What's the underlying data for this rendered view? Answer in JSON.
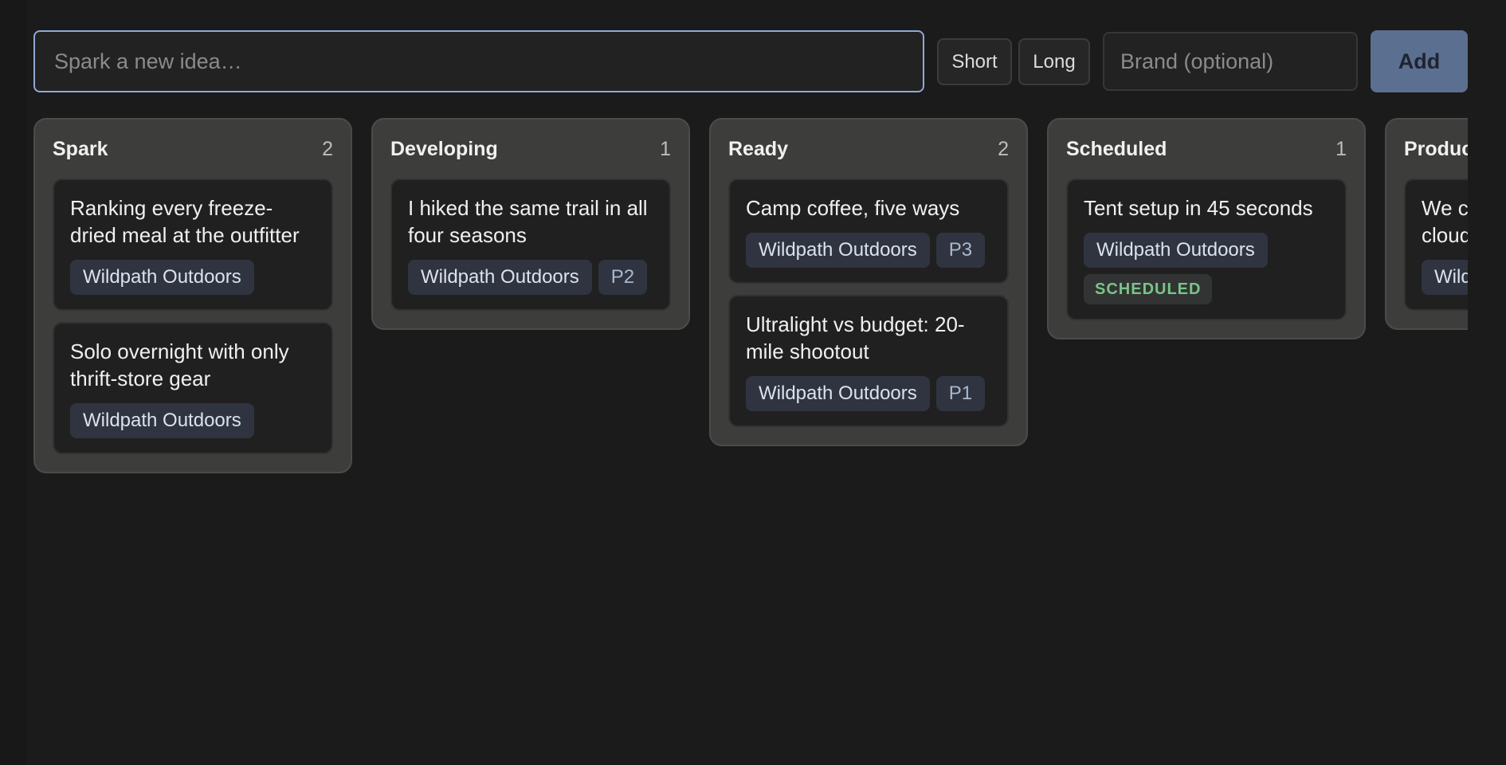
{
  "composer": {
    "idea_placeholder": "Spark a new idea…",
    "length_options": [
      "Short",
      "Long"
    ],
    "brand_placeholder": "Brand (optional)",
    "add_label": "Add"
  },
  "columns": [
    {
      "title": "Spark",
      "count": "2",
      "cards": [
        {
          "title": "Ranking every freeze-dried meal at the outfitter",
          "brand": "Wildpath Outdoors"
        },
        {
          "title": "Solo overnight with only thrift-store gear",
          "brand": "Wildpath Outdoors"
        }
      ]
    },
    {
      "title": "Developing",
      "count": "1",
      "cards": [
        {
          "title": "I hiked the same trail in all four seasons",
          "brand": "Wildpath Outdoors",
          "priority": "P2"
        }
      ]
    },
    {
      "title": "Ready",
      "count": "2",
      "cards": [
        {
          "title": "Camp coffee, five ways",
          "brand": "Wildpath Outdoors",
          "priority": "P3"
        },
        {
          "title": "Ultralight vs budget: 20-mile shootout",
          "brand": "Wildpath Outdoors",
          "priority": "P1"
        }
      ]
    },
    {
      "title": "Scheduled",
      "count": "1",
      "cards": [
        {
          "title": "Tent setup in 45 seconds",
          "brand": "Wildpath Outdoors",
          "status": "SCHEDULED"
        }
      ]
    },
    {
      "title": "Produc",
      "cards": [
        {
          "title": "We c cloud",
          "brand": "Wild"
        }
      ]
    }
  ],
  "colors": {
    "background": "#1b1b1b",
    "column": "#3d3d3c",
    "card": "#202020",
    "accent_focus": "#8ea9d6",
    "add_button": "#5b6f90",
    "tag": "#2f3440",
    "scheduled_text": "#79c48a"
  }
}
